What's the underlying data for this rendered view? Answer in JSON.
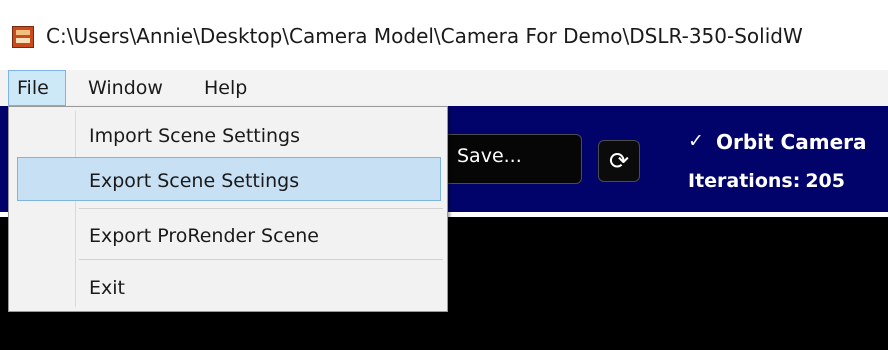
{
  "window": {
    "title": "C:\\Users\\Annie\\Desktop\\Camera Model\\Camera For Demo\\DSLR-350-SolidW",
    "icon": "app-logo-icon"
  },
  "menubar": {
    "items": [
      {
        "label": "File"
      },
      {
        "label": "Window"
      },
      {
        "label": "Help"
      }
    ]
  },
  "file_menu": {
    "items": [
      {
        "label": "Import Scene Settings"
      },
      {
        "label": "Export Scene Settings",
        "highlighted": true
      },
      {
        "label": "Export ProRender Scene"
      },
      {
        "label": "Exit"
      }
    ]
  },
  "toolbar": {
    "save_label": "Save...",
    "refresh_icon": "refresh-icon",
    "refresh_glyph": "⟳",
    "orbit_check_glyph": "✓",
    "orbit_checked": true,
    "orbit_label": "Orbit Camera",
    "iterations_label": "Iterations:",
    "iterations_value": "205"
  },
  "colors": {
    "toolbar_bg": "#02036a",
    "menu_highlight": "#c7e0f4",
    "viewport_bg": "#000000"
  }
}
